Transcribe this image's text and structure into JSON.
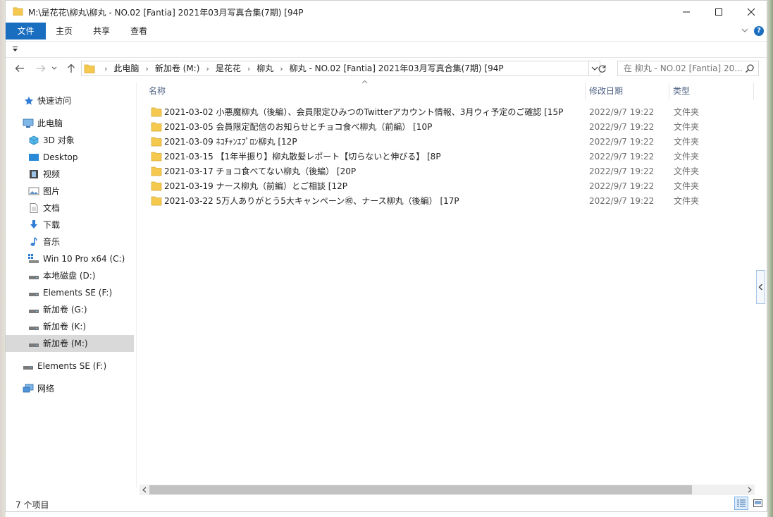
{
  "window": {
    "title": "M:\\是花花\\柳丸\\柳丸 - NO.02 [Fantia] 2021年03月写真合集(7期) [94P"
  },
  "ribbon": {
    "tabs": [
      "文件",
      "主页",
      "共享",
      "查看"
    ]
  },
  "address": {
    "crumbs": [
      "此电脑",
      "新加卷 (M:)",
      "是花花",
      "柳丸",
      "柳丸 - NO.02 [Fantia] 2021年03月写真合集(7期) [94P"
    ]
  },
  "search": {
    "placeholder": "在 柳丸 - NO.02 [Fantia] 20..."
  },
  "nav": {
    "quick_access": "快速访问",
    "this_pc": "此电脑",
    "items": [
      "3D 对象",
      "Desktop",
      "视频",
      "图片",
      "文档",
      "下载",
      "音乐",
      "Win 10 Pro x64 (C:)",
      "本地磁盘 (D:)",
      "Elements SE (F:)",
      "新加卷 (G:)",
      "新加卷 (K:)",
      "新加卷 (M:)"
    ],
    "external": "Elements SE (F:)",
    "network": "网络"
  },
  "columns": {
    "name": "名称",
    "date": "修改日期",
    "type": "类型"
  },
  "files": [
    {
      "name": "2021-03-02 小悪魔柳丸（後編）、会員限定ひみつのTwitterアカウント情報、3月ウィ予定のご確認 [15P",
      "date": "2022/9/7 19:22",
      "type": "文件夹"
    },
    {
      "name": "2021-03-05 会員限定配信のお知らせとチョコ食べ柳丸（前編） [10P",
      "date": "2022/9/7 19:22",
      "type": "文件夹"
    },
    {
      "name": "2021-03-09 ﾈｺﾁｬﾝｴﾌﾟﾛﾝ柳丸 [12P",
      "date": "2022/9/7 19:22",
      "type": "文件夹"
    },
    {
      "name": "2021-03-15 【1年半振り】柳丸散髪レポート【切らないと伸びる】 [8P",
      "date": "2022/9/7 19:22",
      "type": "文件夹"
    },
    {
      "name": "2021-03-17 チョコ食べてない柳丸（後編） [20P",
      "date": "2022/9/7 19:22",
      "type": "文件夹"
    },
    {
      "name": "2021-03-19 ナース柳丸（前編）とご相談 [12P",
      "date": "2022/9/7 19:22",
      "type": "文件夹"
    },
    {
      "name": "2021-03-22 5万人ありがとう5大キャンペーン㊗、ナース柳丸（後編） [17P",
      "date": "2022/9/7 19:22",
      "type": "文件夹"
    }
  ],
  "status": {
    "count": "7 个项目"
  },
  "colors": {
    "accent": "#1a6ec0",
    "folder": "#f5c94d",
    "selected": "#d9d9d9"
  }
}
